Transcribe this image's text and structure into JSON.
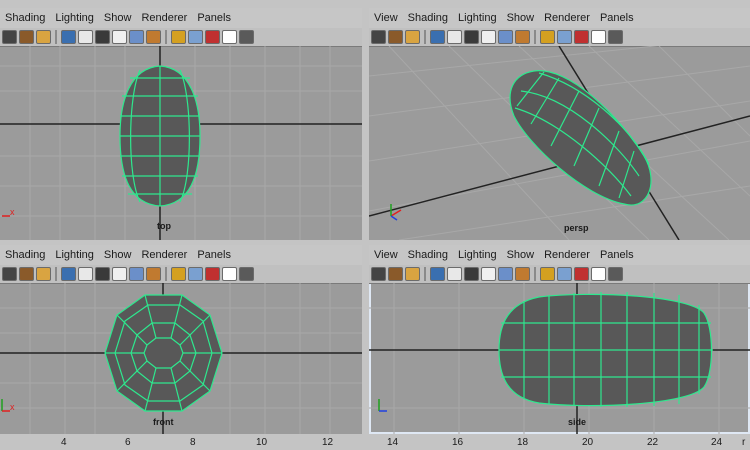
{
  "menu": [
    "View",
    "Shading",
    "Lighting",
    "Show",
    "Renderer",
    "Panels"
  ],
  "menu_left": [
    "Shading",
    "Lighting",
    "Show",
    "Renderer",
    "Panels"
  ],
  "panels": {
    "top": {
      "label": "top"
    },
    "persp": {
      "label": "persp"
    },
    "front": {
      "label": "front"
    },
    "side": {
      "label": "side"
    }
  },
  "axis": {
    "x": "x",
    "y": "y",
    "z": "z"
  },
  "timeline": [
    "4",
    "6",
    "8",
    "10",
    "12",
    "14",
    "16",
    "18",
    "20",
    "22",
    "24"
  ],
  "timeline_end": "r",
  "colors": {
    "mesh": "#2ee88e",
    "mesh_fill": "#585858",
    "grid": "#aaaaaa",
    "axis_line": "#222222"
  }
}
